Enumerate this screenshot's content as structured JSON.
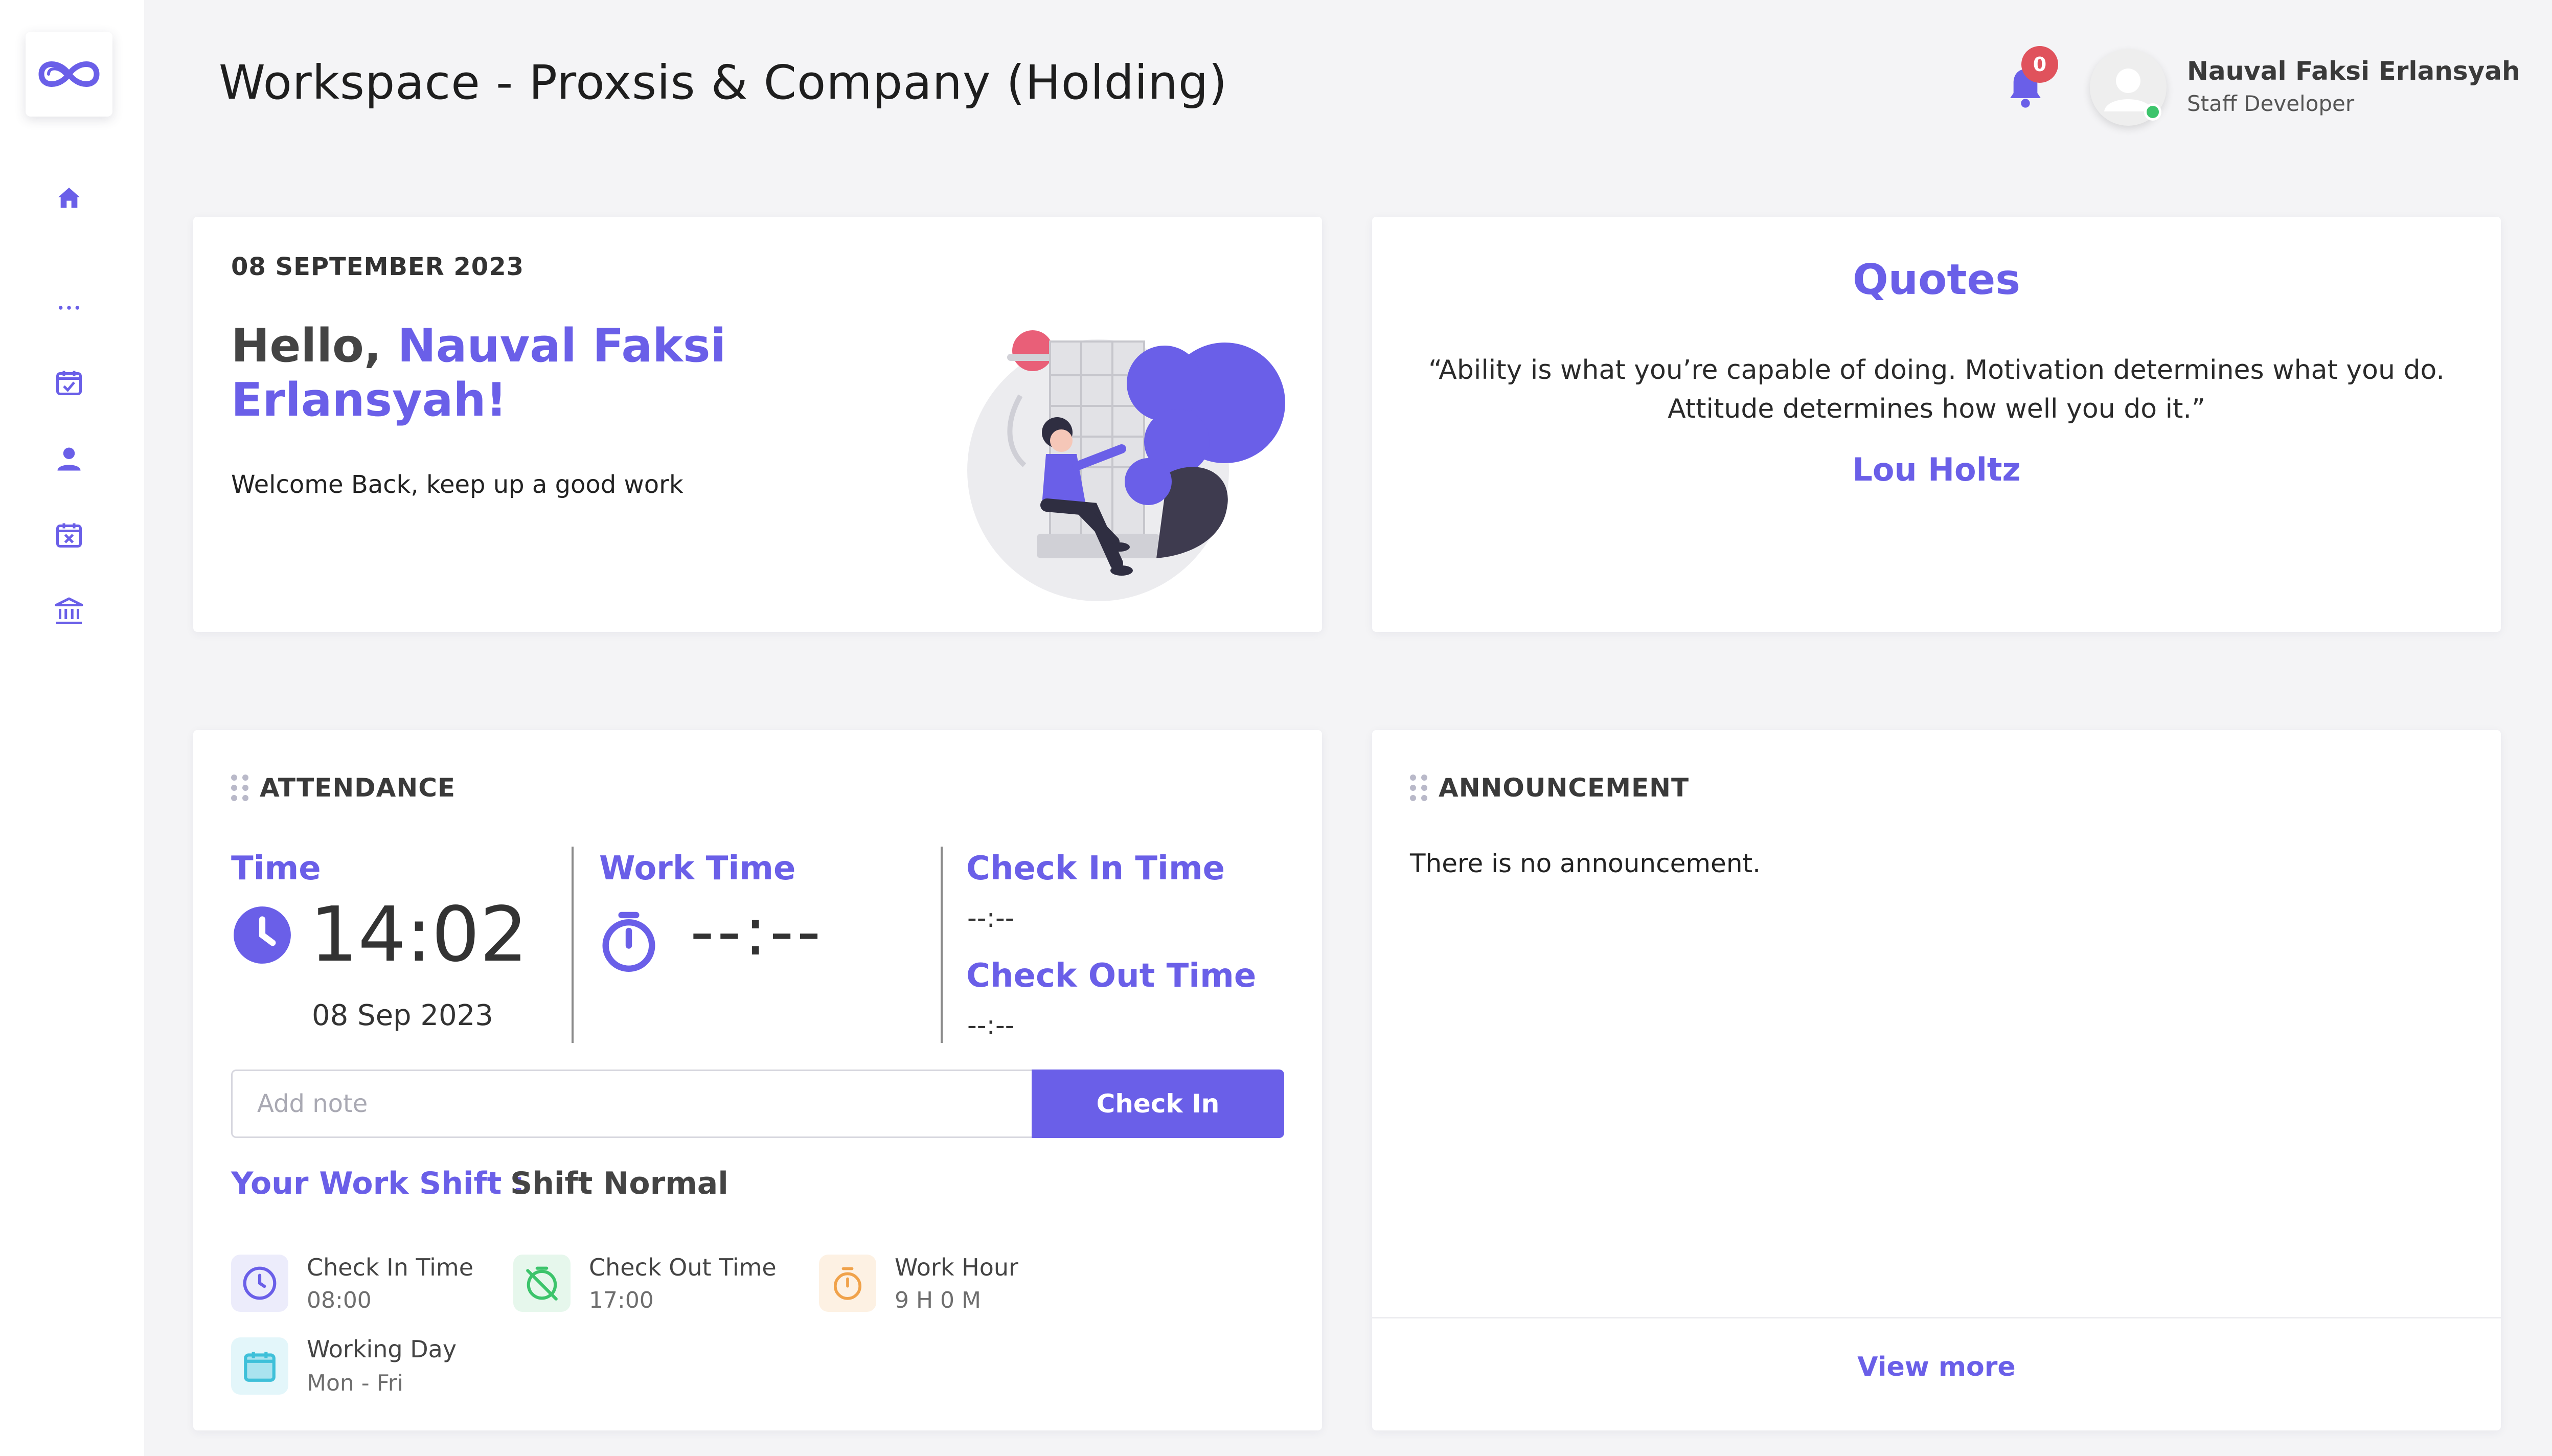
{
  "app": {
    "title": "Workspace - Proxsis & Company (Holding)",
    "accent_color": "#6a5fe8"
  },
  "sidebar": {
    "items": [
      {
        "icon": "home-icon"
      },
      {
        "icon": "more-icon"
      },
      {
        "icon": "calendar-check-icon"
      },
      {
        "icon": "user-icon"
      },
      {
        "icon": "calendar-x-icon"
      },
      {
        "icon": "bank-icon"
      }
    ]
  },
  "header": {
    "notification_count": "0",
    "user_name": "Nauval Faksi Erlansyah",
    "user_role": "Staff Developer"
  },
  "welcome": {
    "date": "08 SEPTEMBER 2023",
    "greeting": "Hello,",
    "name": "Nauval Faksi Erlansyah!",
    "subtitle": "Welcome Back, keep up a good work"
  },
  "quotes": {
    "title": "Quotes",
    "text": "“Ability is what you’re capable of doing. Motivation determines what you do. Attitude determines how well you do it.”",
    "author": "Lou Holtz"
  },
  "attendance": {
    "heading": "ATTENDANCE",
    "time_label": "Time",
    "time_value": "14:02",
    "date_value": "08 Sep 2023",
    "work_time_label": "Work Time",
    "work_time_value": "--:--",
    "check_in_label": "Check In Time",
    "check_in_value": "--:--",
    "check_out_label": "Check Out Time",
    "check_out_value": "--:--",
    "note_placeholder": "Add note",
    "check_in_button": "Check In",
    "shift_label": "Your Work Shift :",
    "shift_value": "Shift Normal",
    "info": [
      {
        "icon": "clock-icon",
        "title": "Check In Time",
        "value": "08:00",
        "color": "#6a5fe8"
      },
      {
        "icon": "timer-off-icon",
        "title": "Check Out Time",
        "value": "17:00",
        "color": "#3cc46b"
      },
      {
        "icon": "stopwatch-icon",
        "title": "Work Hour",
        "value": "9 H 0 M",
        "color": "#f0a24a"
      },
      {
        "icon": "calendar-icon",
        "title": "Working Day",
        "value": "Mon - Fri",
        "color": "#3fc0d9"
      }
    ]
  },
  "announcement": {
    "heading": "ANNOUNCEMENT",
    "empty_text": "There is no announcement.",
    "view_more": "View more"
  }
}
